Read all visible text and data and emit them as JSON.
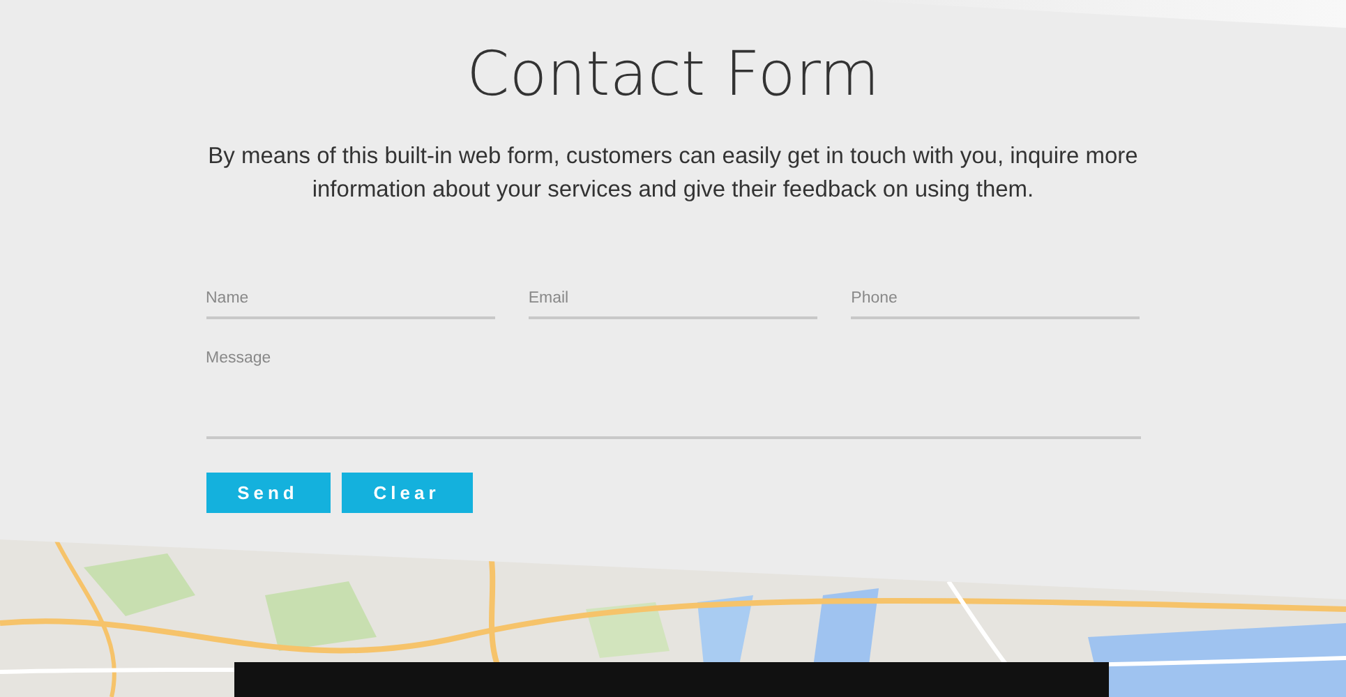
{
  "title": "Contact Form",
  "description": "By means of this built-in web form, customers can easily get in touch with you, inquire more information about your services and give their feedback on using them.",
  "form": {
    "fields": [
      {
        "placeholder": "Name"
      },
      {
        "placeholder": "Email"
      },
      {
        "placeholder": "Phone"
      }
    ],
    "message": {
      "placeholder": "Message"
    },
    "buttons": [
      "Send",
      "Clear"
    ]
  }
}
